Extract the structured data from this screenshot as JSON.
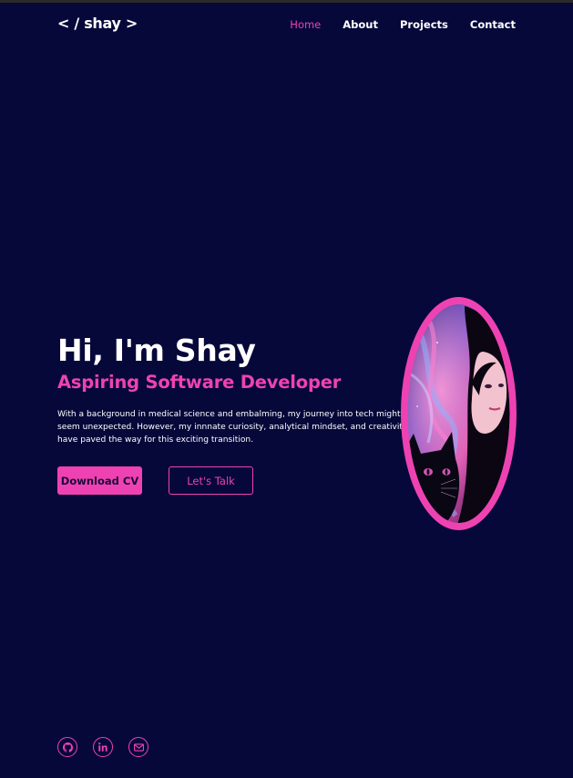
{
  "header": {
    "logo": "< / shay >",
    "nav": [
      {
        "label": "Home",
        "active": true
      },
      {
        "label": "About",
        "active": false
      },
      {
        "label": "Projects",
        "active": false
      },
      {
        "label": "Contact",
        "active": false
      }
    ]
  },
  "hero": {
    "title": "Hi, I'm Shay",
    "subtitle": "Aspiring Software Developer",
    "description": "With a background in medical science and embalming, my journey into tech might seem unexpected. However, my innnate curiosity, analytical mindset, and creativity have paved the way for this exciting transition.",
    "primary_button": "Download CV",
    "secondary_button": "Let's Talk",
    "image_icon": "portrait-illustration-woman-with-black-cat"
  },
  "socials": [
    {
      "icon": "github-icon"
    },
    {
      "icon": "linkedin-icon"
    },
    {
      "icon": "email-icon"
    }
  ],
  "colors": {
    "background": "#06083a",
    "accent": "#ef42b2",
    "text": "#ffffff"
  }
}
